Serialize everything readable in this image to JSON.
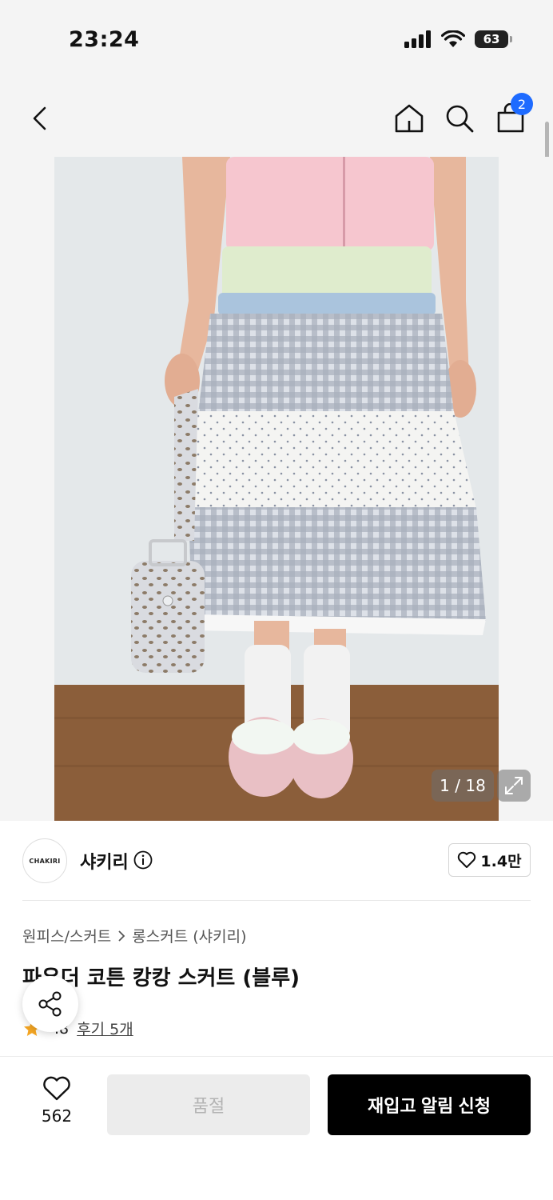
{
  "status_bar": {
    "time": "23:24",
    "battery": "63"
  },
  "nav": {
    "cart_count": "2"
  },
  "gallery": {
    "counter": "1 / 18"
  },
  "seller": {
    "logo_text": "CHAKIRI",
    "name": "샤키리",
    "likes": "1.4만"
  },
  "product": {
    "breadcrumb": [
      "원피스/스커트",
      "롱스커트 (샤키리)"
    ],
    "title": "파우더 코튼 캉캉 스커트 (블루)",
    "rating": ".8",
    "review_label": "후기 5개"
  },
  "bottom_bar": {
    "wish_count": "562",
    "soldout_label": "품절",
    "restock_label": "재입고 알림 신청"
  },
  "colors": {
    "accent_blue": "#1e6bff",
    "star": "#f5a623",
    "primary_button": "#000000"
  },
  "icons": [
    "back-icon",
    "home-icon",
    "search-icon",
    "cart-icon",
    "expand-icon",
    "info-icon",
    "heart-icon",
    "share-icon",
    "star-icon",
    "signal-icon",
    "wifi-icon"
  ]
}
